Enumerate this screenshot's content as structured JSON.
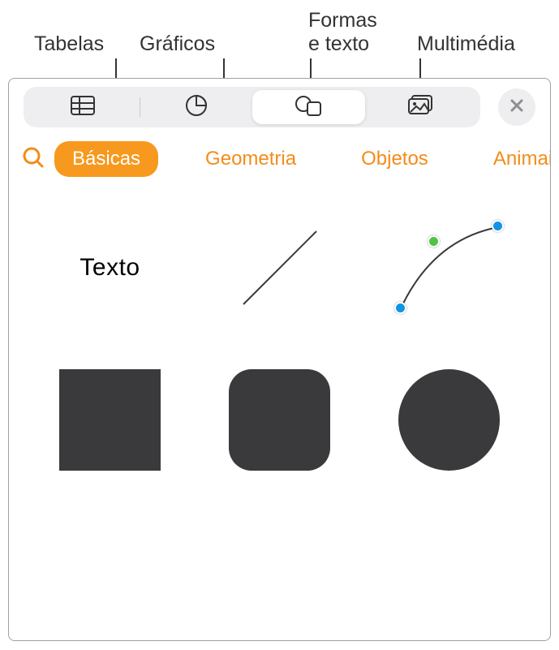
{
  "callouts": {
    "tables": "Tabelas",
    "charts": "Gráficos",
    "shapes_text_l1": "Formas",
    "shapes_text_l2": "e texto",
    "media": "Multimédia"
  },
  "categories": {
    "search": "",
    "basic": "Básicas",
    "geometry": "Geometria",
    "objects": "Objetos",
    "animals": "Animais"
  },
  "shapes": {
    "text_label": "Texto"
  }
}
